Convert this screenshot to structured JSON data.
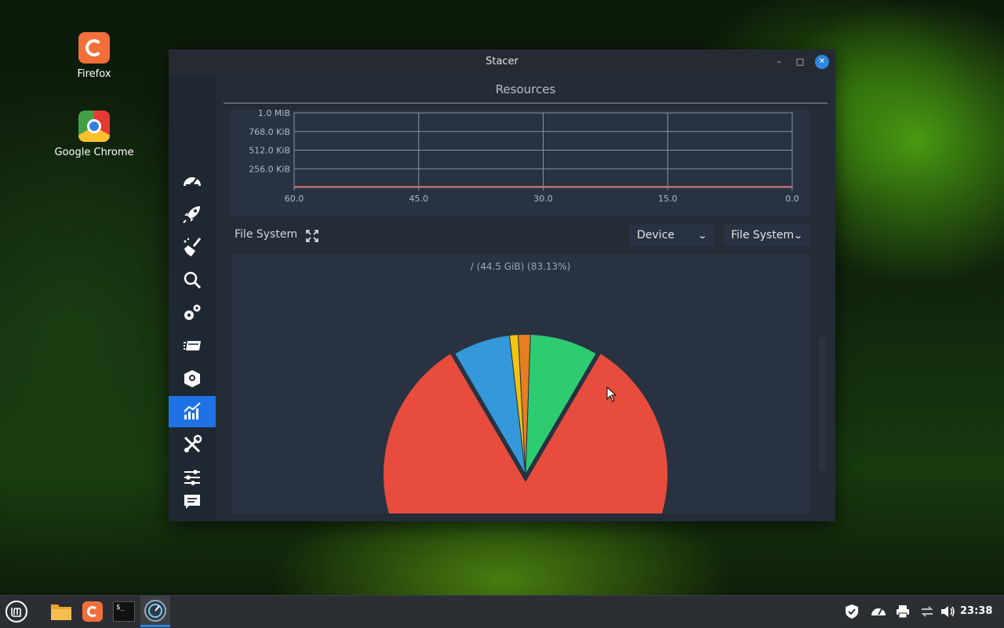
{
  "desktop": {
    "icons": [
      {
        "label": "Firefox",
        "icon": "firefox-icon"
      },
      {
        "label": "Google Chrome",
        "icon": "chrome-icon"
      }
    ]
  },
  "window": {
    "title": "Stacer",
    "controls": {
      "minimize": "–",
      "maximize": "□",
      "close": "✕"
    }
  },
  "sidebar": {
    "items": [
      {
        "name": "dashboard",
        "icon": "speedometer-icon"
      },
      {
        "name": "startup-apps",
        "icon": "rocket-icon"
      },
      {
        "name": "system-cleaner",
        "icon": "broom-icon"
      },
      {
        "name": "search",
        "icon": "search-icon"
      },
      {
        "name": "services",
        "icon": "gears-icon"
      },
      {
        "name": "processes",
        "icon": "stack-icon"
      },
      {
        "name": "uninstaller",
        "icon": "package-icon"
      },
      {
        "name": "resources",
        "icon": "chart-icon",
        "active": true
      },
      {
        "name": "helpers",
        "icon": "tools-icon"
      },
      {
        "name": "settings",
        "icon": "sliders-icon"
      }
    ],
    "feedback_icon": "feedback-icon"
  },
  "resources": {
    "title": "Resources",
    "filesystem_label": "File System",
    "device_dropdown": "Device",
    "filesystem_dropdown": "File System",
    "pie_caption": "/ (44.5 GiB) (83.13%)"
  },
  "chart_data": [
    {
      "type": "line",
      "y_ticks": [
        "1.0 MiB",
        "768.0 KiB",
        "512.0 KiB",
        "256.0 KiB"
      ],
      "x_ticks": [
        "60.0",
        "45.0",
        "30.0",
        "15.0",
        "0.0"
      ],
      "x": [
        60,
        45,
        30,
        15,
        0
      ],
      "series": [
        {
          "values": [
            0,
            0,
            0,
            0,
            0
          ],
          "color": "#e8675e"
        }
      ],
      "ylim": [
        0,
        1024
      ],
      "grid": true
    },
    {
      "type": "pie",
      "title": "/ (44.5 GiB) (83.13%)",
      "slices": [
        {
          "value": 83.13,
          "color": "#e74c3c"
        },
        {
          "value": 6.6,
          "color": "#3498db"
        },
        {
          "value": 1.0,
          "color": "#f1c40f"
        },
        {
          "value": 1.4,
          "color": "#e67e22"
        },
        {
          "value": 7.87,
          "color": "#2ecc71"
        }
      ]
    }
  ],
  "taskbar": {
    "apps": [
      "menu-icon",
      "files-icon",
      "firefox-icon",
      "terminal-icon",
      "stacer-icon"
    ],
    "clock": "23:38"
  }
}
